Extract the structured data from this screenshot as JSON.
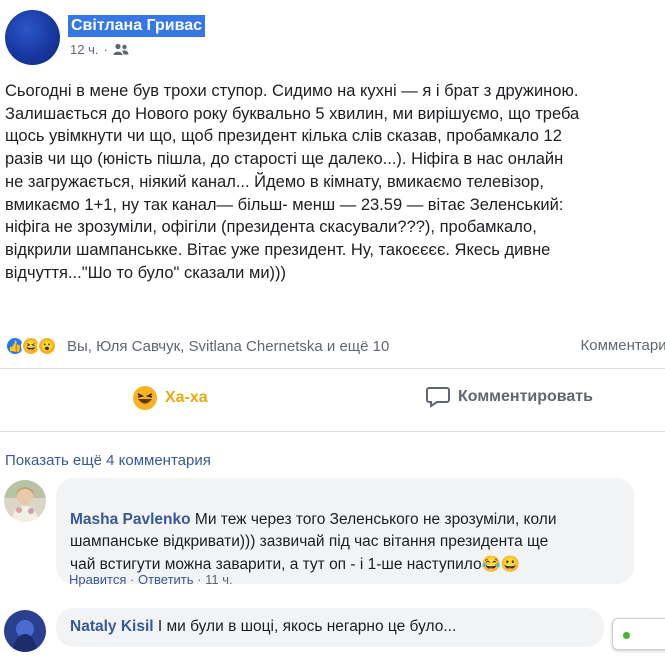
{
  "post": {
    "author": "Світлана Гривас",
    "time": "12 ч.",
    "separator": "·",
    "text": "Сьогодні в мене був трохи ступор. Сидимо на кухні — я і брат з дружиною.\nЗалишається до Нового року буквально 5 хвилин, ми вирішуємо, що треба\nщось увімкнути чи що, щоб президент кілька слів сказав, пробамкало 12\nразів чи що (юність пішла, до старості ще далеко...). Ніфіга в нас онлайн\nне загружається, ніякий канал... Йдемо в кімнату, вмикаємо телевізор,\nвмикаємо 1+1, ну так канал— більш- менш — 23.59 — вітає Зеленський:\nніфіга не зрозуміли, офігіли (президента скасували???), пробамкало,\nвідкрили шампанськке. Вітає уже президент. Ну, такоєєєє. Якесь дивне\nвідчуття...\"Шо то було\" сказали ми)))"
  },
  "reactions": {
    "icons": [
      "like-icon",
      "haha-icon",
      "wow-icon"
    ],
    "names": "Вы, Юля Савчук, Svitlana Chernetska и ещё 10",
    "comments_link": "Комментарии"
  },
  "actions": {
    "haha_label": "Ха-ха",
    "comment_label": "Комментировать"
  },
  "comments_section": {
    "more_label": "Показать ещё 4 комментария",
    "comments": [
      {
        "author": "Masha Pavlenko",
        "text": "Ми теж через того Зеленського не зрозуміли, коли\nшампанське відкривати))) зазвичай під час вітання президента ще\nчай встигути можна заварити, а тут оп - і 1-ше наступило😂😀",
        "like_label": "Нравится",
        "reply_label": "Ответить",
        "time": "11 ч."
      },
      {
        "author": "Nataly Kisil",
        "text": "І ми були в шоці, якось негарно це було..."
      }
    ]
  },
  "colors": {
    "link": "#385898",
    "haha": "#e9a90c",
    "author_highlight": "#3578e5",
    "online": "#42b72a"
  }
}
